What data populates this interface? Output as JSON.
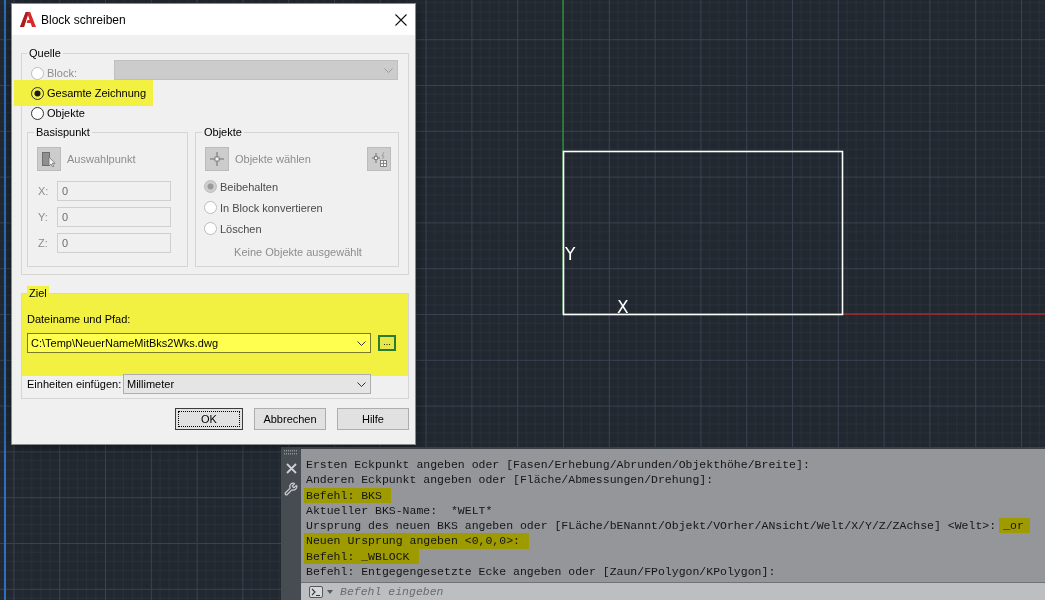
{
  "dialog": {
    "title": "Block schreiben",
    "source": {
      "legend": "Quelle",
      "options": [
        {
          "label": "Block:",
          "selected": false,
          "disabled": true,
          "highlighted": false
        },
        {
          "label": "Gesamte Zeichnung",
          "selected": true,
          "disabled": false,
          "highlighted": true
        },
        {
          "label": "Objekte",
          "selected": false,
          "disabled": false,
          "highlighted": false
        }
      ],
      "block_select": {
        "disabled": true
      },
      "base_point": {
        "legend": "Basispunkt",
        "pick_button": {
          "label": "Auswahlpunkt",
          "disabled": true
        },
        "coordinates": [
          {
            "label": "X:",
            "value": "0",
            "disabled": true
          },
          {
            "label": "Y:",
            "value": "0",
            "disabled": true
          },
          {
            "label": "Z:",
            "value": "0",
            "disabled": true
          }
        ]
      },
      "objects": {
        "legend": "Objekte",
        "select_button": {
          "label": "Objekte wählen",
          "disabled": true
        },
        "quick_select": {
          "disabled": true
        },
        "options": [
          {
            "label": "Beibehalten",
            "selected": true,
            "disabled": true
          },
          {
            "label": "In Block konvertieren",
            "selected": false,
            "disabled": true
          },
          {
            "label": "Löschen",
            "selected": false,
            "disabled": true
          }
        ],
        "status": "Keine Objekte ausgewählt"
      }
    },
    "target": {
      "legend": "Ziel",
      "highlighted": true,
      "file_label": "Dateiname und Pfad:",
      "file_path": "C:\\Temp\\NeuerNameMitBks2Wks.dwg",
      "browse_button": {
        "label": "...",
        "focused": true
      },
      "units_label": "Einheiten einfügen:",
      "units": "Millimeter"
    },
    "buttons": [
      {
        "label": "OK",
        "default": true
      },
      {
        "label": "Abbrechen",
        "default": false
      },
      {
        "label": "Hilfe",
        "default": false
      }
    ]
  },
  "command_line": {
    "history": [
      {
        "segments": [
          {
            "text": "Ersten Eckpunkt angeben oder [Fasen/Erhebung/Abrunden/Objekthöhe/Breite]:",
            "highlighted": false
          }
        ]
      },
      {
        "segments": [
          {
            "text": "Anderen Eckpunkt angeben oder [Fläche/Abmessungen/Drehung]:",
            "highlighted": false
          }
        ]
      },
      {
        "segments": [
          {
            "text": "Befehl: BKS",
            "highlighted": true
          }
        ]
      },
      {
        "segments": [
          {
            "text": "Aktueller BKS-Name:  *WELT*",
            "highlighted": false
          }
        ]
      },
      {
        "segments": [
          {
            "text": "Ursprung des neuen BKS angeben oder [FLäche/bENannt/Objekt/VOrher/ANsicht/Welt/X/Y/Z/ZAchse] <Welt>:",
            "highlighted": false
          },
          {
            "text": "_or",
            "highlighted": true
          }
        ]
      },
      {
        "segments": [
          {
            "text": "Neuen Ursprung angeben <0,0,0>:",
            "highlighted": true
          }
        ]
      },
      {
        "segments": [
          {
            "text": "Befehl: _WBLOCK",
            "highlighted": true
          }
        ]
      },
      {
        "segments": [
          {
            "text": "Befehl: Entgegengesetzte Ecke angeben oder [Zaun/FPolygon/KPolygon]:",
            "highlighted": false
          }
        ]
      }
    ],
    "placeholder": "Befehl eingeben"
  },
  "canvas": {
    "ucs_icon": {
      "x_label": "X",
      "y_label": "Y"
    }
  }
}
